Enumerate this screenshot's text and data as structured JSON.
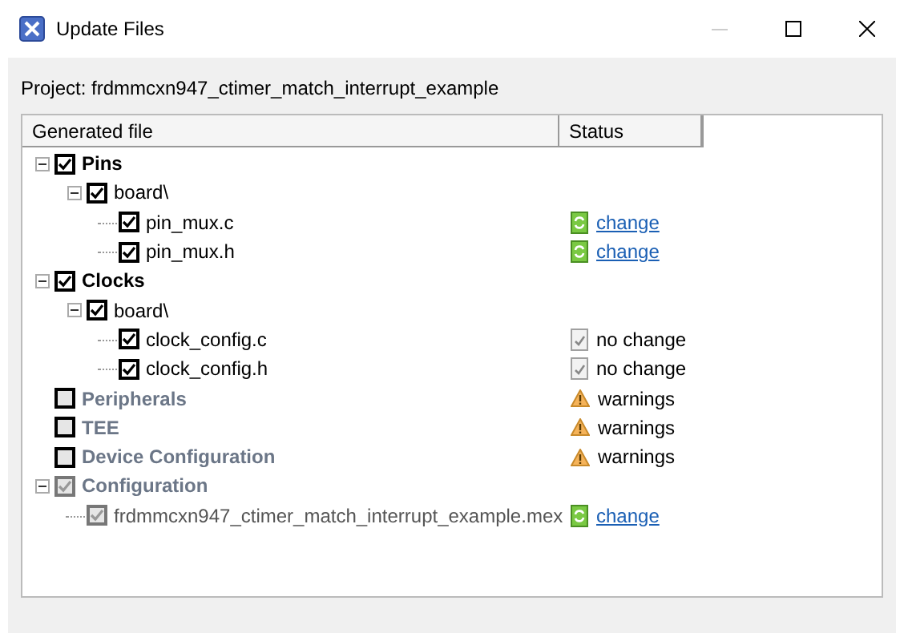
{
  "window": {
    "title": "Update Files"
  },
  "project": "Project: frdmmcxn947_ctimer_match_interrupt_example",
  "table": {
    "columns": [
      "Generated file",
      "Status"
    ],
    "rows": [
      {
        "label": "Pins",
        "checked": true,
        "disabled": false,
        "expanded": true,
        "children": [
          {
            "label": "board\\",
            "checked": true,
            "disabled": false,
            "expanded": true,
            "children": [
              {
                "label": "pin_mux.c",
                "checked": true,
                "disabled": false,
                "status": {
                  "kind": "change",
                  "text": "change"
                }
              },
              {
                "label": "pin_mux.h",
                "checked": true,
                "disabled": false,
                "status": {
                  "kind": "change",
                  "text": "change"
                }
              }
            ]
          }
        ]
      },
      {
        "label": "Clocks",
        "checked": true,
        "disabled": false,
        "expanded": true,
        "children": [
          {
            "label": "board\\",
            "checked": true,
            "disabled": false,
            "expanded": true,
            "children": [
              {
                "label": "clock_config.c",
                "checked": true,
                "disabled": false,
                "status": {
                  "kind": "nochange",
                  "text": "no change"
                }
              },
              {
                "label": "clock_config.h",
                "checked": true,
                "disabled": false,
                "status": {
                  "kind": "nochange",
                  "text": "no change"
                }
              }
            ]
          }
        ]
      },
      {
        "label": "Peripherals",
        "checked": false,
        "disabled": true,
        "status": {
          "kind": "warning",
          "text": "warnings"
        }
      },
      {
        "label": "TEE",
        "checked": false,
        "disabled": true,
        "status": {
          "kind": "warning",
          "text": "warnings"
        }
      },
      {
        "label": "Device Configuration",
        "checked": false,
        "disabled": true,
        "status": {
          "kind": "warning",
          "text": "warnings"
        }
      },
      {
        "label": "Configuration",
        "checked": true,
        "disabled": true,
        "expanded": true,
        "children": [
          {
            "label": "frdmmcxn947_ctimer_match_interrupt_example.mex",
            "checked": true,
            "disabled": true,
            "status": {
              "kind": "change",
              "text": "change"
            }
          }
        ]
      }
    ]
  }
}
